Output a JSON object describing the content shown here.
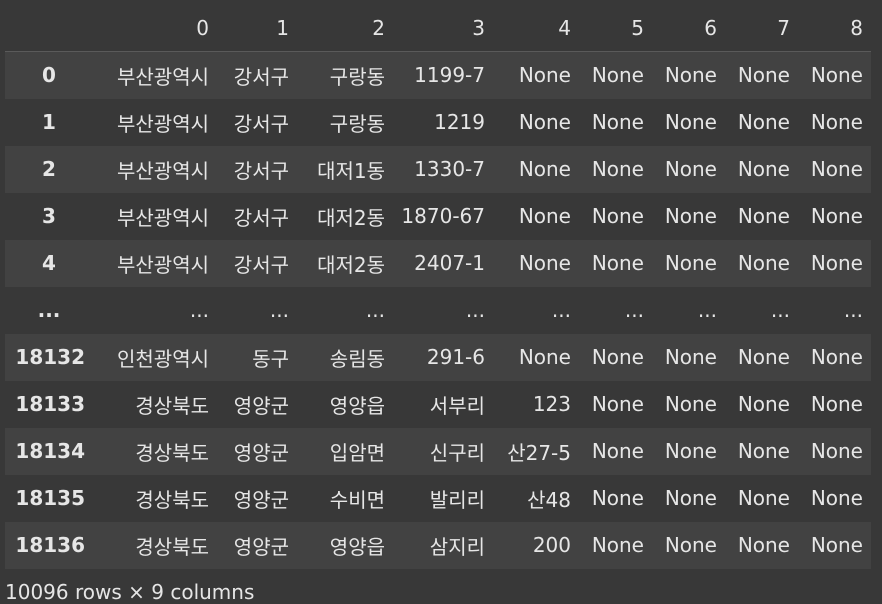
{
  "dataframe": {
    "columns": [
      "0",
      "1",
      "2",
      "3",
      "4",
      "5",
      "6",
      "7",
      "8"
    ],
    "rows": [
      {
        "index": "0",
        "cells": [
          "부산광역시",
          "강서구",
          "구랑동",
          "1199-7",
          "None",
          "None",
          "None",
          "None",
          "None"
        ]
      },
      {
        "index": "1",
        "cells": [
          "부산광역시",
          "강서구",
          "구랑동",
          "1219",
          "None",
          "None",
          "None",
          "None",
          "None"
        ]
      },
      {
        "index": "2",
        "cells": [
          "부산광역시",
          "강서구",
          "대저1동",
          "1330-7",
          "None",
          "None",
          "None",
          "None",
          "None"
        ]
      },
      {
        "index": "3",
        "cells": [
          "부산광역시",
          "강서구",
          "대저2동",
          "1870-67",
          "None",
          "None",
          "None",
          "None",
          "None"
        ]
      },
      {
        "index": "4",
        "cells": [
          "부산광역시",
          "강서구",
          "대저2동",
          "2407-1",
          "None",
          "None",
          "None",
          "None",
          "None"
        ]
      },
      {
        "index": "...",
        "cells": [
          "...",
          "...",
          "...",
          "...",
          "...",
          "...",
          "...",
          "...",
          "..."
        ]
      },
      {
        "index": "18132",
        "cells": [
          "인천광역시",
          "동구",
          "송림동",
          "291-6",
          "None",
          "None",
          "None",
          "None",
          "None"
        ]
      },
      {
        "index": "18133",
        "cells": [
          "경상북도",
          "영양군",
          "영양읍",
          "서부리",
          "123",
          "None",
          "None",
          "None",
          "None"
        ]
      },
      {
        "index": "18134",
        "cells": [
          "경상북도",
          "영양군",
          "입암면",
          "신구리",
          "산27-5",
          "None",
          "None",
          "None",
          "None"
        ]
      },
      {
        "index": "18135",
        "cells": [
          "경상북도",
          "영양군",
          "수비면",
          "발리리",
          "산48",
          "None",
          "None",
          "None",
          "None"
        ]
      },
      {
        "index": "18136",
        "cells": [
          "경상북도",
          "영양군",
          "영양읍",
          "삼지리",
          "200",
          "None",
          "None",
          "None",
          "None"
        ]
      }
    ],
    "shape_text": "10096 rows × 9 columns"
  }
}
